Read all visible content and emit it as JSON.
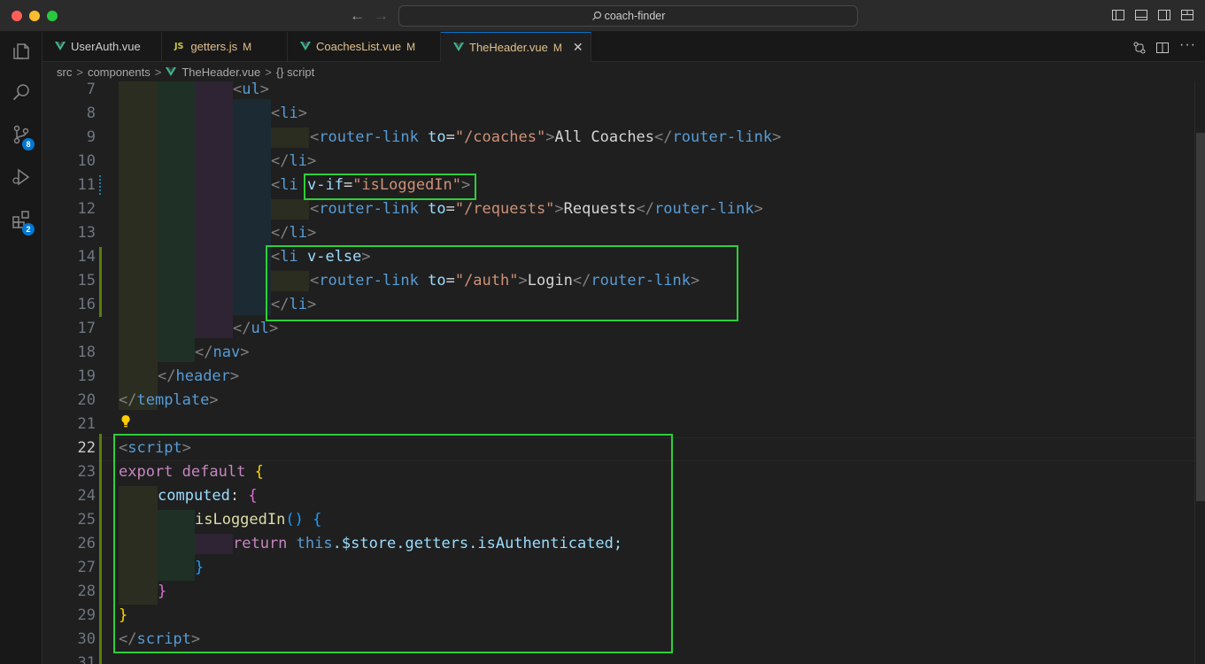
{
  "window": {
    "search_label": "coach-finder"
  },
  "colors": {
    "accent": "#0078d4",
    "highlight_box": "#2ece3a",
    "modified": "#e2c08d",
    "vue_green": "#41b883"
  },
  "activity_bar": {
    "items": [
      {
        "name": "explorer-icon"
      },
      {
        "name": "search-icon"
      },
      {
        "name": "source-control-icon",
        "badge": "8"
      },
      {
        "name": "run-debug-icon"
      },
      {
        "name": "extensions-icon",
        "badge": "2"
      }
    ]
  },
  "tabs": [
    {
      "label": "UserAuth.vue",
      "modified": "",
      "type": "vue"
    },
    {
      "label": "getters.js",
      "modified": "M",
      "type": "js",
      "type_label": "JS"
    },
    {
      "label": "CoachesList.vue",
      "modified": "M",
      "type": "vue"
    },
    {
      "label": "TheHeader.vue",
      "modified": "M",
      "type": "vue",
      "active": true,
      "close": "✕"
    }
  ],
  "breadcrumb": {
    "part1": "src",
    "part2": "components",
    "part3": "TheHeader.vue",
    "part4": "{} script",
    "sep": ">"
  },
  "lines": [
    "7",
    "8",
    "9",
    "10",
    "11",
    "12",
    "13",
    "14",
    "15",
    "16",
    "17",
    "18",
    "19",
    "20",
    "21",
    "22",
    "23",
    "24",
    "25",
    "26",
    "27",
    "28",
    "29",
    "30",
    "31"
  ],
  "code": {
    "l7": {
      "open": "<",
      "tag": "ul",
      "close": ">"
    },
    "l8": {
      "open": "<",
      "tag": "li",
      "close": ">"
    },
    "l9": {
      "open": "<",
      "tag": "router-link",
      "attr": "to",
      "eq": "=",
      "val": "\"/coaches\"",
      "close": ">",
      "text": "All Coaches",
      "endopen": "</",
      "endtag": "router-link",
      "endclose": ">"
    },
    "l10": {
      "open": "</",
      "tag": "li",
      "close": ">"
    },
    "l11": {
      "open": "<",
      "tag": "li",
      "attr": "v-if",
      "eq": "=",
      "val": "\"isLoggedIn\"",
      "close": ">"
    },
    "l12": {
      "open": "<",
      "tag": "router-link",
      "attr": "to",
      "eq": "=",
      "val": "\"/requests\"",
      "close": ">",
      "text": "Requests",
      "endopen": "</",
      "endtag": "router-link",
      "endclose": ">"
    },
    "l13": {
      "open": "</",
      "tag": "li",
      "close": ">"
    },
    "l14": {
      "open": "<",
      "tag": "li",
      "attr": "v-else",
      "close": ">"
    },
    "l15": {
      "open": "<",
      "tag": "router-link",
      "attr": "to",
      "eq": "=",
      "val": "\"/auth\"",
      "close": ">",
      "text": "Login",
      "endopen": "</",
      "endtag": "router-link",
      "endclose": ">"
    },
    "l16": {
      "open": "</",
      "tag": "li",
      "close": ">"
    },
    "l17": {
      "open": "</",
      "tag": "ul",
      "close": ">"
    },
    "l18": {
      "open": "</",
      "tag": "nav",
      "close": ">"
    },
    "l19": {
      "open": "</",
      "tag": "header",
      "close": ">"
    },
    "l20": {
      "open": "</",
      "tag": "template",
      "close": ">"
    },
    "l22": {
      "open": "<",
      "tag": "script",
      "close": ">"
    },
    "l23": {
      "kw1": "export",
      "kw2": "default",
      "brace": "{"
    },
    "l24": {
      "prop": "computed",
      "colon": ":",
      "brace": "{"
    },
    "l25": {
      "fn": "isLoggedIn",
      "parens": "()",
      "brace": "{"
    },
    "l26": {
      "kw": "return",
      "this": "this",
      "rest": ".$store.getters.isAuthenticated;"
    },
    "l27": {
      "brace": "}"
    },
    "l28": {
      "brace": "}"
    },
    "l29": {
      "brace": "}"
    },
    "l30": {
      "open": "</",
      "tag": "script",
      "close": ">"
    }
  }
}
